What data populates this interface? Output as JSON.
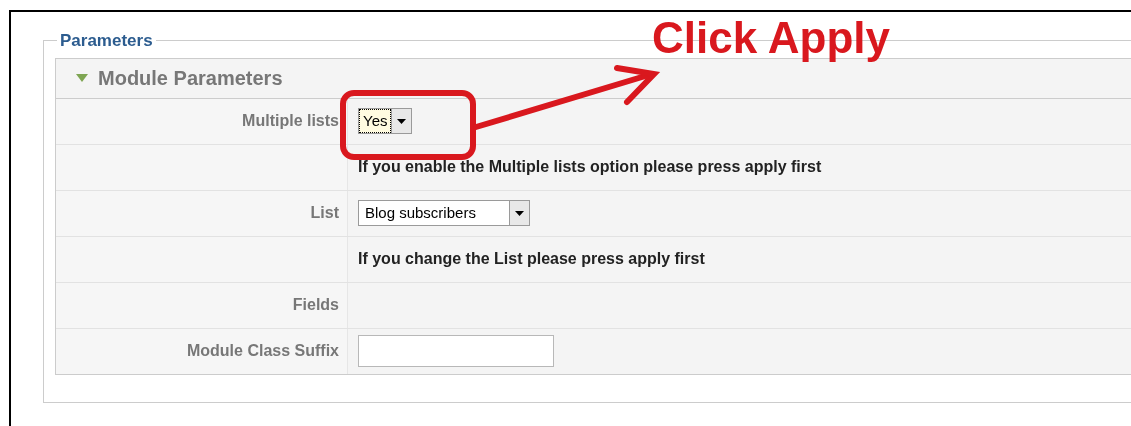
{
  "fieldset": {
    "legend": "Parameters"
  },
  "panel": {
    "title": "Module Parameters",
    "expanded": true
  },
  "rows": [
    {
      "kind": "select",
      "label": "Multiple lists",
      "value": "Yes",
      "focused": true
    },
    {
      "kind": "note",
      "text": "If you enable the Multiple lists option please press apply first"
    },
    {
      "kind": "select",
      "label": "List",
      "value": "Blog subscribers",
      "focused": false
    },
    {
      "kind": "note",
      "text": "If you change the List please press apply first"
    },
    {
      "kind": "empty",
      "label": "Fields"
    },
    {
      "kind": "text",
      "label": "Module Class Suffix"
    }
  ],
  "annotation": {
    "text": "Click Apply"
  }
}
